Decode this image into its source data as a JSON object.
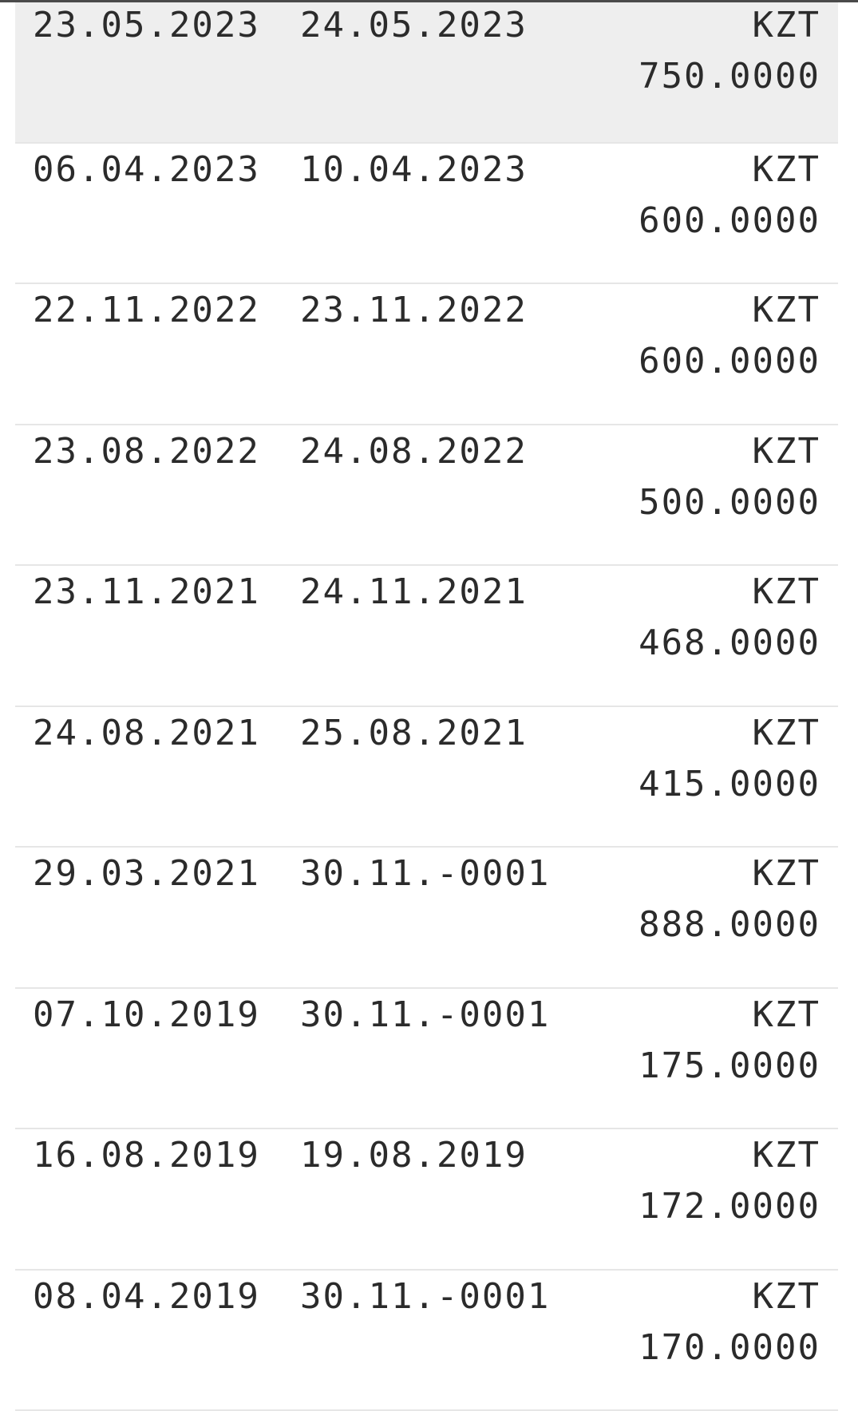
{
  "rows": [
    {
      "date1": "23.05.2023",
      "date2": "24.05.2023",
      "currency": "KZT",
      "amount": "750.0000"
    },
    {
      "date1": "06.04.2023",
      "date2": "10.04.2023",
      "currency": "KZT",
      "amount": "600.0000"
    },
    {
      "date1": "22.11.2022",
      "date2": "23.11.2022",
      "currency": "KZT",
      "amount": "600.0000"
    },
    {
      "date1": "23.08.2022",
      "date2": "24.08.2022",
      "currency": "KZT",
      "amount": "500.0000"
    },
    {
      "date1": "23.11.2021",
      "date2": "24.11.2021",
      "currency": "KZT",
      "amount": "468.0000"
    },
    {
      "date1": "24.08.2021",
      "date2": "25.08.2021",
      "currency": "KZT",
      "amount": "415.0000"
    },
    {
      "date1": "29.03.2021",
      "date2": "30.11.-0001",
      "currency": "KZT",
      "amount": "888.0000"
    },
    {
      "date1": "07.10.2019",
      "date2": "30.11.-0001",
      "currency": "KZT",
      "amount": "175.0000"
    },
    {
      "date1": "16.08.2019",
      "date2": "19.08.2019",
      "currency": "KZT",
      "amount": "172.0000"
    },
    {
      "date1": "08.04.2019",
      "date2": "30.11.-0001",
      "currency": "KZT",
      "amount": "170.0000"
    }
  ],
  "colors": {
    "highlight_row": "#eeeeee",
    "divider": "#e6e6e6",
    "text": "#2b2b2b"
  }
}
